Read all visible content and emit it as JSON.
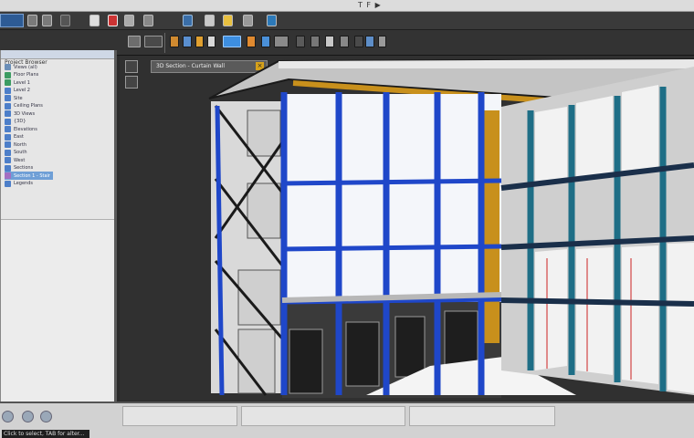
{
  "window": {
    "title": "T F ▶",
    "accent": "#1e4fc4"
  },
  "quick_access": {
    "items": [
      "open-icon",
      "save-icon",
      "undo-icon",
      "redo-icon",
      "print-icon",
      "measure-icon",
      "sync-icon",
      "3d-view-icon",
      "close-window-icon"
    ]
  },
  "ribbon": {
    "groups": [
      "modify",
      "view",
      "annotate",
      "collaborate"
    ]
  },
  "project_browser": {
    "header": "Project Browser",
    "items": [
      {
        "label": "Views (all)",
        "icon": "#6b8fb8"
      },
      {
        "label": "Floor Plans",
        "icon": "#3c9c62"
      },
      {
        "label": "Level 1",
        "icon": "#3c9c62"
      },
      {
        "label": "Level 2",
        "icon": "#4d7fc9"
      },
      {
        "label": "Site",
        "icon": "#4d7fc9"
      },
      {
        "label": "Ceiling Plans",
        "icon": "#4d7fc9"
      },
      {
        "label": "3D Views",
        "icon": "#4d7fc9"
      },
      {
        "label": "{3D}",
        "icon": "#4d7fc9"
      },
      {
        "label": "Elevations",
        "icon": "#4d7fc9"
      },
      {
        "label": "East",
        "icon": "#4d7fc9"
      },
      {
        "label": "North",
        "icon": "#4d7fc9"
      },
      {
        "label": "South",
        "icon": "#4d7fc9"
      },
      {
        "label": "West",
        "icon": "#4d7fc9"
      },
      {
        "label": "Sections",
        "icon": "#4d7fc9"
      },
      {
        "label": "Section 1 - Stair",
        "icon": "#a36fc2",
        "selected": true
      },
      {
        "label": "Legends",
        "icon": "#4d7fc9"
      }
    ]
  },
  "viewport": {
    "tab_label": "3D Section - Curtain Wall",
    "model": {
      "mullion_color": "#1f47c9",
      "glass_color": "#f4f6fa",
      "slab_color": "#b7b7b7",
      "timber_color": "#c8901c",
      "teal_mullion_color": "#1e6e86"
    }
  },
  "status_bar": {
    "text": "Click to select, TAB for alter..."
  }
}
